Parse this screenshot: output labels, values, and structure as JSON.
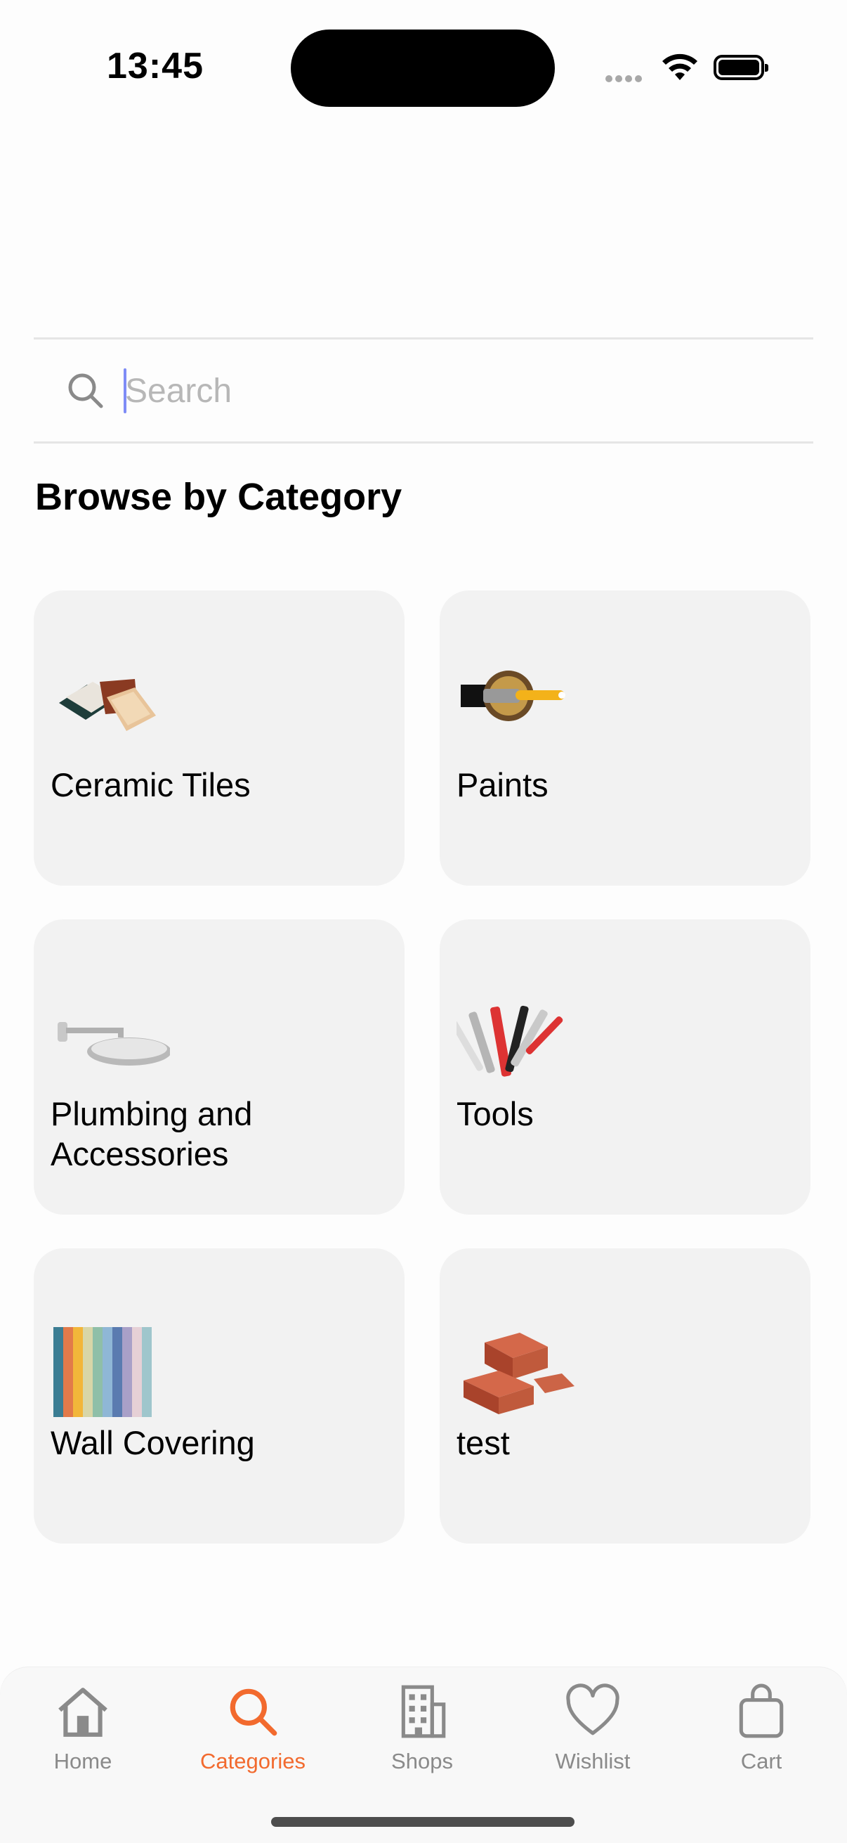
{
  "status_bar": {
    "time": "13:45"
  },
  "search": {
    "placeholder": "Search",
    "value": ""
  },
  "section": {
    "title": "Browse by Category"
  },
  "categories": [
    {
      "label": "Ceramic Tiles",
      "icon": "ceramic-tiles-icon"
    },
    {
      "label": "Paints",
      "icon": "paint-brush-icon"
    },
    {
      "label": "Plumbing and Accessories",
      "icon": "shower-head-icon"
    },
    {
      "label": "Tools",
      "icon": "tools-icon"
    },
    {
      "label": "Wall Covering",
      "icon": "wall-covering-icon"
    },
    {
      "label": "test",
      "icon": "bricks-icon"
    }
  ],
  "tabbar": {
    "items": [
      {
        "label": "Home",
        "icon": "home-icon",
        "active": false
      },
      {
        "label": "Categories",
        "icon": "search-icon",
        "active": true
      },
      {
        "label": "Shops",
        "icon": "building-icon",
        "active": false
      },
      {
        "label": "Wishlist",
        "icon": "heart-icon",
        "active": false
      },
      {
        "label": "Cart",
        "icon": "bag-icon",
        "active": false
      }
    ]
  },
  "colors": {
    "accent": "#f26a2e",
    "card_bg": "#f2f2f2",
    "caret": "#7e8cf6"
  }
}
